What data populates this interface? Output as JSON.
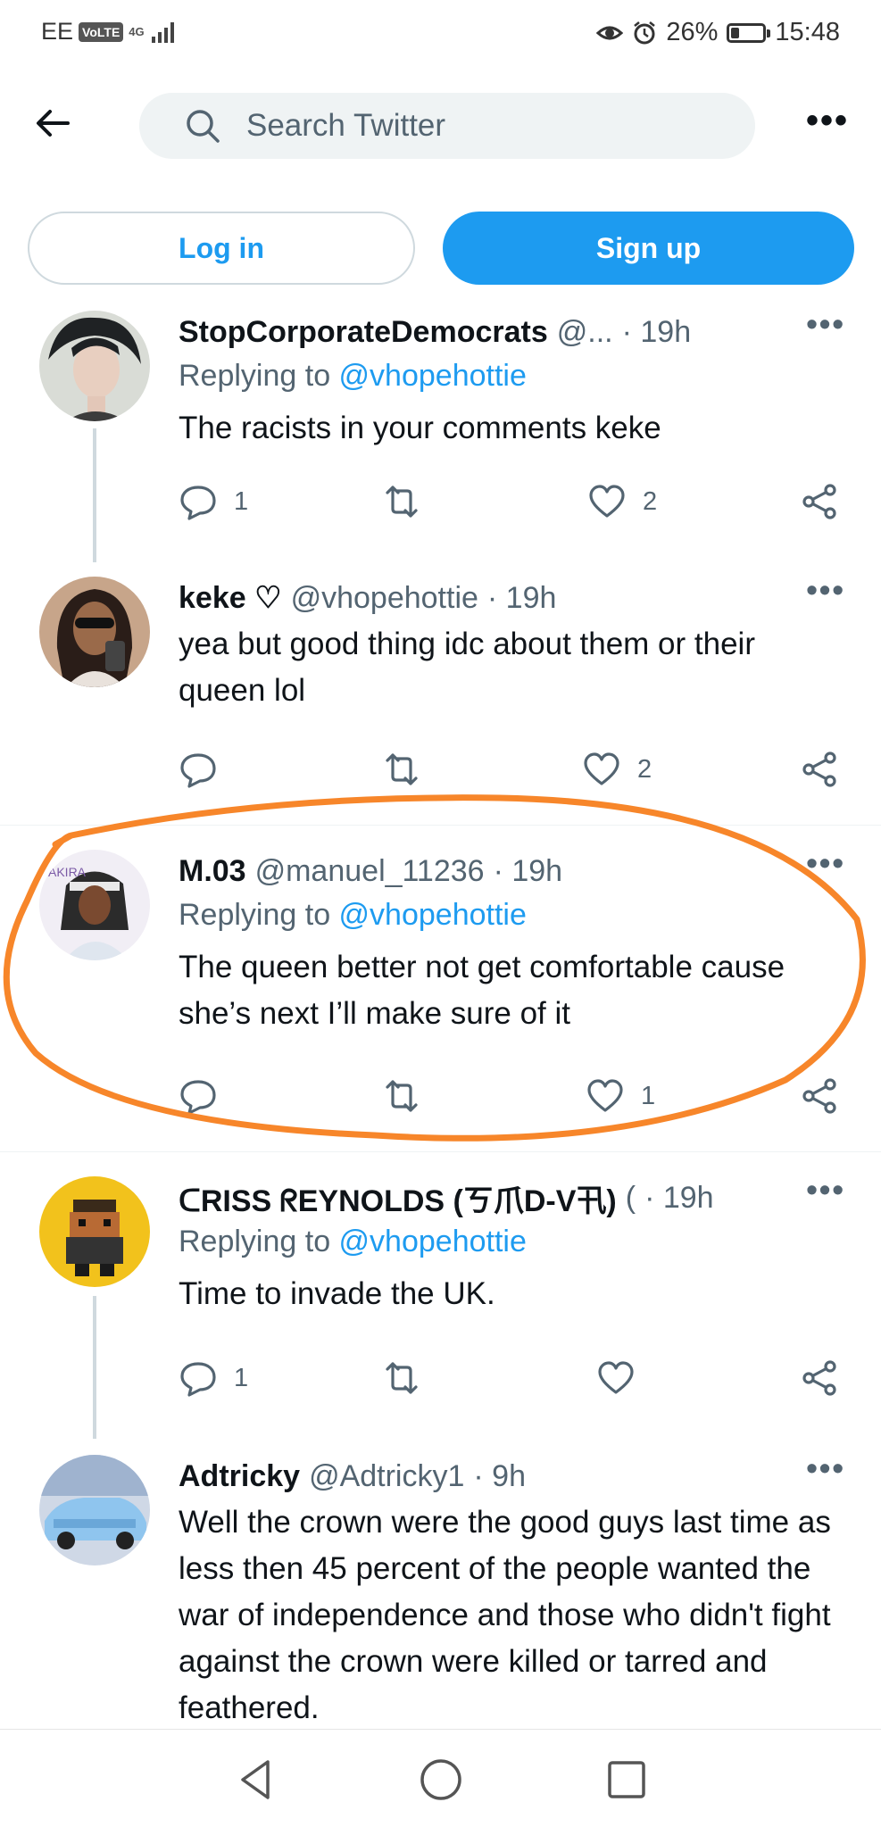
{
  "status_bar": {
    "carrier": "EE",
    "volte": "VoLTE",
    "network": "4G",
    "battery_percent": "26%",
    "battery_level": 0.26,
    "time": "15:48"
  },
  "search": {
    "placeholder": "Search Twitter"
  },
  "auth": {
    "login_label": "Log in",
    "signup_label": "Sign up"
  },
  "tweets": [
    {
      "name": "StopCorporateDemocrats",
      "handle": "@...",
      "time": "· 19h",
      "replying_label": "Replying to ",
      "replying_to": "@vhopehottie",
      "text": "The racists in your comments keke",
      "replies": "1",
      "retweets": "",
      "likes": "2"
    },
    {
      "name": "keke ♡",
      "handle": "@vhopehottie",
      "time": "· 19h",
      "text": "yea but good thing idc about them or their queen lol",
      "replies": "",
      "retweets": "",
      "likes": "2"
    },
    {
      "name": "M.03",
      "handle": "@manuel_11236",
      "time": "· 19h",
      "replying_label": "Replying to ",
      "replying_to": "@vhopehottie",
      "text": "The queen better not get comfortable cause she’s next I’ll make sure of it",
      "replies": "",
      "retweets": "",
      "likes": "1"
    },
    {
      "name": "ᑕRISS ᖇEYNOLDS (ㄎ爪D-V卂)",
      "handle": "(",
      "time": "· 19h",
      "replying_label": "Replying to ",
      "replying_to": "@vhopehottie",
      "text": "Time to invade the UK.",
      "replies": "1",
      "retweets": "",
      "likes": ""
    },
    {
      "name": "Adtricky",
      "handle": "@Adtricky1",
      "time": "· 9h",
      "text": "Well the crown were the good guys last time as less then 45 percent of the people wanted the war of independence and those who didn't fight against the crown were killed or tarred and feathered."
    }
  ],
  "colors": {
    "accent": "#1d9bf0",
    "annotation": "#f7862a"
  }
}
